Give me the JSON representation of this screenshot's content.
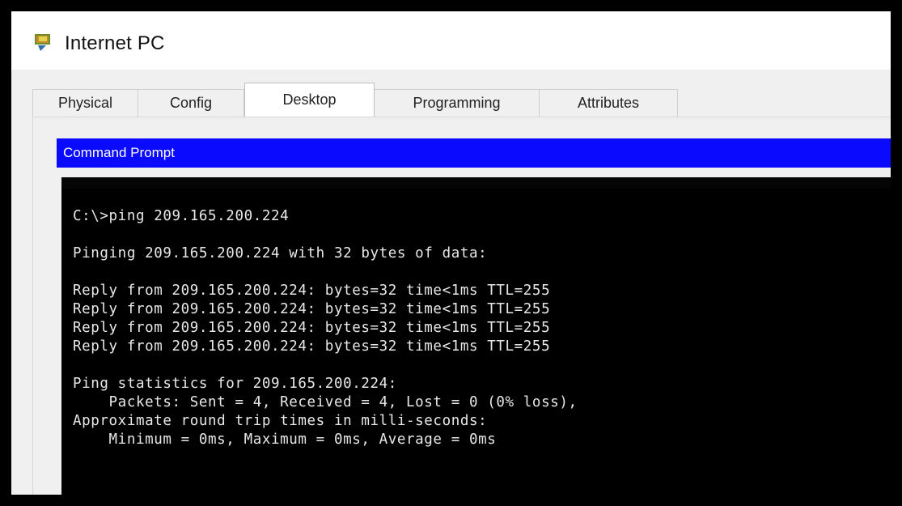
{
  "window": {
    "title": "Internet PC"
  },
  "tabs": [
    {
      "label": "Physical"
    },
    {
      "label": "Config"
    },
    {
      "label": "Desktop"
    },
    {
      "label": "Programming"
    },
    {
      "label": "Attributes"
    }
  ],
  "active_tab": "Desktop",
  "command_prompt": {
    "title": "Command Prompt",
    "lines": [
      "C:\\>ping 209.165.200.224",
      "Pinging 209.165.200.224 with 32 bytes of data:",
      "Reply from 209.165.200.224: bytes=32 time<1ms TTL=255",
      "Reply from 209.165.200.224: bytes=32 time<1ms TTL=255",
      "Reply from 209.165.200.224: bytes=32 time<1ms TTL=255",
      "Reply from 209.165.200.224: bytes=32 time<1ms TTL=255",
      "Ping statistics for 209.165.200.224:",
      "    Packets: Sent = 4, Received = 4, Lost = 0 (0% loss),",
      "Approximate round trip times in milli-seconds:",
      "    Minimum = 0ms, Maximum = 0ms, Average = 0ms"
    ]
  },
  "colors": {
    "command_prompt_header": "#0a0aff",
    "console_background": "#000000",
    "console_text": "#e8e8e8"
  },
  "icons": {
    "app": "packet-tracer-pc-icon"
  }
}
